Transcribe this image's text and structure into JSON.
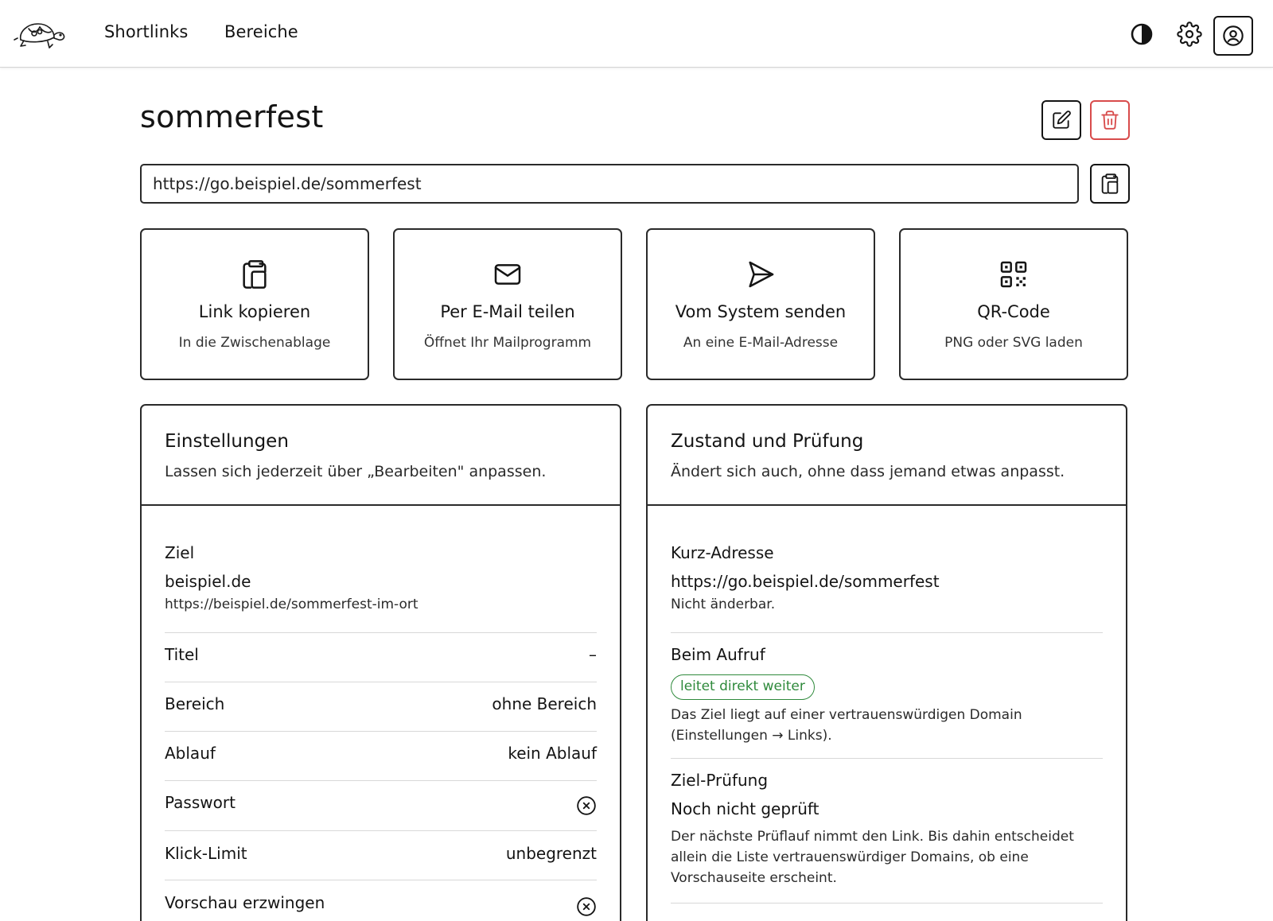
{
  "nav": {
    "links": [
      "Shortlinks",
      "Bereiche"
    ]
  },
  "page": {
    "title": "sommerfest",
    "short_url": "https://go.beispiel.de/sommerfest"
  },
  "actions": [
    {
      "icon": "clipboard-icon",
      "title": "Link kopieren",
      "subtitle": "In die Zwischenablage"
    },
    {
      "icon": "mail-icon",
      "title": "Per E-Mail teilen",
      "subtitle": "Öffnet Ihr Mailprogramm"
    },
    {
      "icon": "send-icon",
      "title": "Vom System senden",
      "subtitle": "An eine E-Mail-Adresse"
    },
    {
      "icon": "qr-code-icon",
      "title": "QR-Code",
      "subtitle": "PNG oder SVG laden"
    }
  ],
  "settings": {
    "title": "Einstellungen",
    "description": "Lassen sich jederzeit über „Bearbeiten\" anpassen.",
    "target_label": "Ziel",
    "target_domain": "beispiel.de",
    "target_url": "https://beispiel.de/sommerfest-im-ort",
    "rows": [
      {
        "label": "Titel",
        "value": "–"
      },
      {
        "label": "Bereich",
        "value": "ohne Bereich"
      },
      {
        "label": "Ablauf",
        "value": "kein Ablauf"
      },
      {
        "label": "Passwort",
        "value": null
      },
      {
        "label": "Klick-Limit",
        "value": "unbegrenzt"
      },
      {
        "label": "Vorschau erzwingen",
        "value": null
      }
    ]
  },
  "status": {
    "title": "Zustand und Prüfung",
    "description": "Ändert sich auch, ohne dass jemand etwas anpasst.",
    "short_label": "Kurz-Adresse",
    "short_value": "https://go.beispiel.de/sommerfest",
    "short_note": "Nicht änderbar.",
    "call_label": "Beim Aufruf",
    "call_badge": "leitet direkt weiter",
    "call_note_1": "Das Ziel liegt auf einer vertrauenswürdigen Domain",
    "call_note_2": "(Einstellungen → Links).",
    "check_label": "Ziel-Prüfung",
    "check_value": "Noch nicht geprüft",
    "check_note_1": "Der nächste Prüflauf nimmt den Link. Bis dahin entscheidet",
    "check_note_2": "allein die Liste vertrauenswürdiger Domains, ob eine",
    "check_note_3": "Vorschauseite erscheint."
  },
  "colors": {
    "accent_green": "#2f8a3c",
    "danger_red": "#d84b4b"
  }
}
